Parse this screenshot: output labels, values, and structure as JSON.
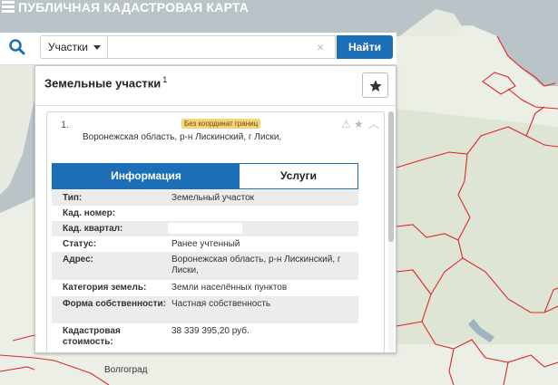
{
  "app": {
    "title": "ПУБЛИЧНАЯ КАДАСТРОВАЯ КАРТА"
  },
  "search": {
    "type_selected": "Участки",
    "query_value": "",
    "clear_glyph": "×",
    "submit_label": "Найти",
    "icon": "search-icon"
  },
  "panel": {
    "title": "Земельные участки",
    "count": "1",
    "favorite_icon": "star-icon"
  },
  "result": {
    "index": "1.",
    "badge": "Без координат границ",
    "address_line": "Воронежская область, р-н Лискинский, г Лиски,",
    "action_icons": [
      "warning-icon",
      "star-icon",
      "chevron-up-icon"
    ]
  },
  "tabs": [
    {
      "label": "Информация",
      "active": true
    },
    {
      "label": "Услуги",
      "active": false
    }
  ],
  "attributes": [
    {
      "key": "Тип:",
      "value": "Земельный участок"
    },
    {
      "key": "Кад. номер:",
      "value": ""
    },
    {
      "key": "Кад. квартал:",
      "value": ""
    },
    {
      "key": "Статус:",
      "value": "Ранее учтенный"
    },
    {
      "key": "Адрес:",
      "value": "Воронежская область, р-н Лискинский, г Лиски,"
    },
    {
      "key": "Категория земель:",
      "value": "Земли населённых пунктов"
    },
    {
      "key": "Форма собственности:",
      "value": "Частная собственность"
    },
    {
      "key": "Кадастровая стоимость:",
      "value": "38 339 395,20 руб."
    }
  ],
  "map": {
    "labels": [
      {
        "text": "Волгоград"
      }
    ]
  },
  "colors": {
    "accent": "#1c6fb7",
    "badge": "#f6d57a",
    "land": "#ecefe6",
    "water": "#b9c3c8",
    "boundary": "#e0262a"
  }
}
